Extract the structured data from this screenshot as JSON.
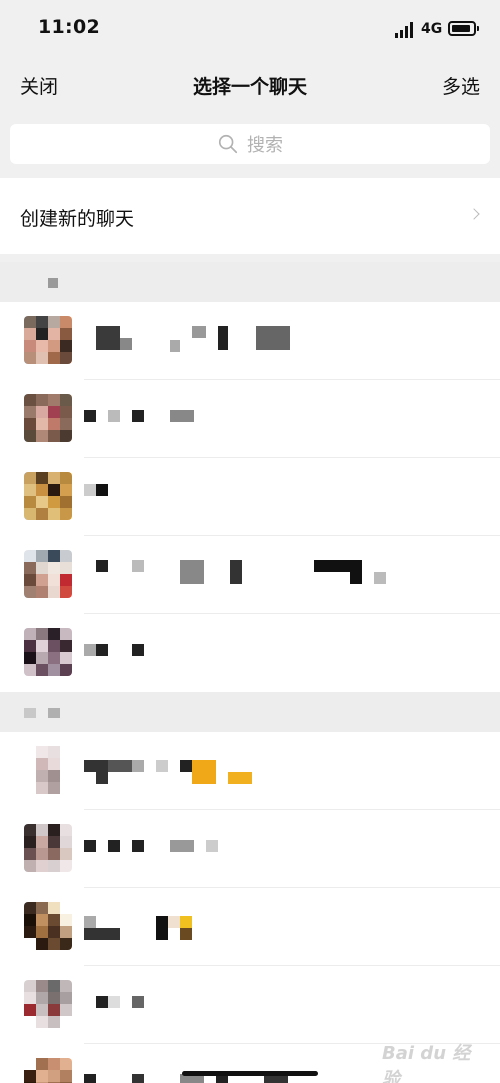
{
  "status_bar": {
    "time": "11:02",
    "network": "4G"
  },
  "nav": {
    "close_label": "关闭",
    "title": "选择一个聊天",
    "multi_select_label": "多选"
  },
  "search": {
    "placeholder": "搜索"
  },
  "new_chat": {
    "label": "创建新的聊天"
  },
  "watermark": {
    "text": "Bai du 经验"
  },
  "colors": {
    "background": "#f0f0f0",
    "card": "#ffffff",
    "placeholder": "#b2b2b2",
    "text": "#111111"
  },
  "icons": [
    "search-icon",
    "chevron-right-icon",
    "signal-icon",
    "battery-icon"
  ]
}
